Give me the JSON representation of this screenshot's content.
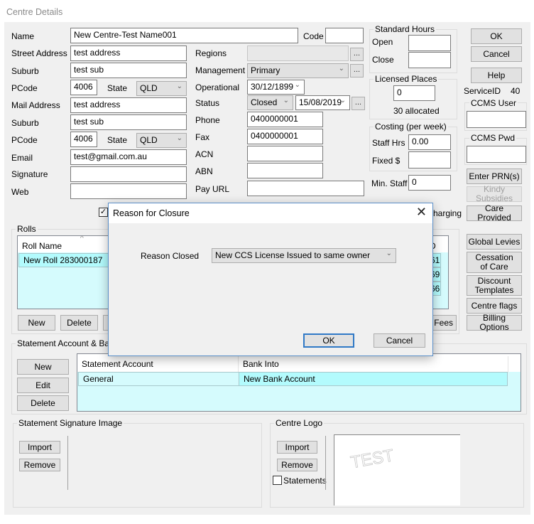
{
  "window": {
    "title": "Centre Details"
  },
  "form": {
    "name": {
      "label": "Name",
      "value": "New Centre-Test Name001"
    },
    "code": {
      "label": "Code",
      "value": ""
    },
    "street_address": {
      "label": "Street Address",
      "value": "test address"
    },
    "suburb1": {
      "label": "Suburb",
      "value": "test sub"
    },
    "pcode1": {
      "label": "PCode",
      "value": "4006"
    },
    "state1": {
      "label": "State",
      "value": "QLD"
    },
    "mail_address": {
      "label": "Mail Address",
      "value": "test address"
    },
    "suburb2": {
      "label": "Suburb",
      "value": "test sub"
    },
    "pcode2": {
      "label": "PCode",
      "value": "4006"
    },
    "state2": {
      "label": "State",
      "value": "QLD"
    },
    "email": {
      "label": "Email",
      "value": "test@gmail.com.au"
    },
    "signature": {
      "label": "Signature",
      "value": ""
    },
    "web": {
      "label": "Web",
      "value": ""
    },
    "regions": {
      "label": "Regions",
      "value": ""
    },
    "management": {
      "label": "Management",
      "value": "Primary"
    },
    "operational": {
      "label": "Operational",
      "value": "30/12/1899"
    },
    "status": {
      "label": "Status",
      "value": "Closed",
      "date": "15/08/2019"
    },
    "phone": {
      "label": "Phone",
      "value": "0400000001"
    },
    "fax": {
      "label": "Fax",
      "value": "0400000001"
    },
    "acn": {
      "label": "ACN",
      "value": ""
    },
    "abn": {
      "label": "ABN",
      "value": ""
    },
    "pay_url": {
      "label": "Pay URL",
      "value": ""
    },
    "ellipsis": "...",
    "charging_fragment": "harging"
  },
  "standard_hours": {
    "title": "Standard Hours",
    "open_label": "Open",
    "open_value": "",
    "close_label": "Close",
    "close_value": ""
  },
  "licensed_places": {
    "title": "Licensed Places",
    "value": "0",
    "allocated": "30 allocated"
  },
  "costing": {
    "title": "Costing (per week)",
    "staff_hrs_label": "Staff Hrs",
    "staff_hrs_value": "0.00",
    "fixed_label": "Fixed $",
    "fixed_value": ""
  },
  "min_staff": {
    "label": "Min. Staff",
    "value": "0"
  },
  "right_buttons": {
    "ok": "OK",
    "cancel": "Cancel",
    "help": "Help",
    "service_id_label": "ServiceID",
    "service_id_value": "40",
    "ccms_user_title": "CCMS User",
    "ccms_user_value": "",
    "ccms_pwd_title": "CCMS Pwd",
    "ccms_pwd_value": "",
    "enter_prn": "Enter PRN(s)",
    "kindy_subsidies": "Kindy Subsidies",
    "care_provided": "Care Provided",
    "global_levies": "Global Levies",
    "cessation_of_care": "Cessation of Care",
    "discount_templates": "Discount Templates",
    "centre_flags": "Centre flags",
    "billing_options": "Billing Options"
  },
  "rolls": {
    "title": "Rolls",
    "columns": [
      "Roll Name",
      "D"
    ],
    "rows": [
      {
        "name": "New Roll 283000187",
        "id_fragment": "61"
      }
    ],
    "id_fragments": [
      "61",
      "69",
      "66"
    ],
    "buttons": {
      "new": "New",
      "delete": "Delete",
      "fees_fragment": "t Fees"
    }
  },
  "statement_account": {
    "title": "Statement Account & Bank",
    "columns": [
      "Statement Account",
      "Bank Into"
    ],
    "rows": [
      {
        "account": "General",
        "bank": "New Bank Account"
      }
    ],
    "buttons": {
      "new": "New",
      "edit": "Edit",
      "delete": "Delete"
    }
  },
  "signature_image": {
    "title": "Statement Signature Image",
    "import": "Import",
    "remove": "Remove"
  },
  "centre_logo": {
    "title": "Centre Logo",
    "import": "Import",
    "remove": "Remove",
    "statements_label": "Statements",
    "statements_checked": false,
    "logo_text": "TEST"
  },
  "dialog": {
    "title": "Reason for Closure",
    "reason_label": "Reason Closed",
    "reason_value": "New CCS License Issued to same owner",
    "ok": "OK",
    "cancel": "Cancel"
  }
}
